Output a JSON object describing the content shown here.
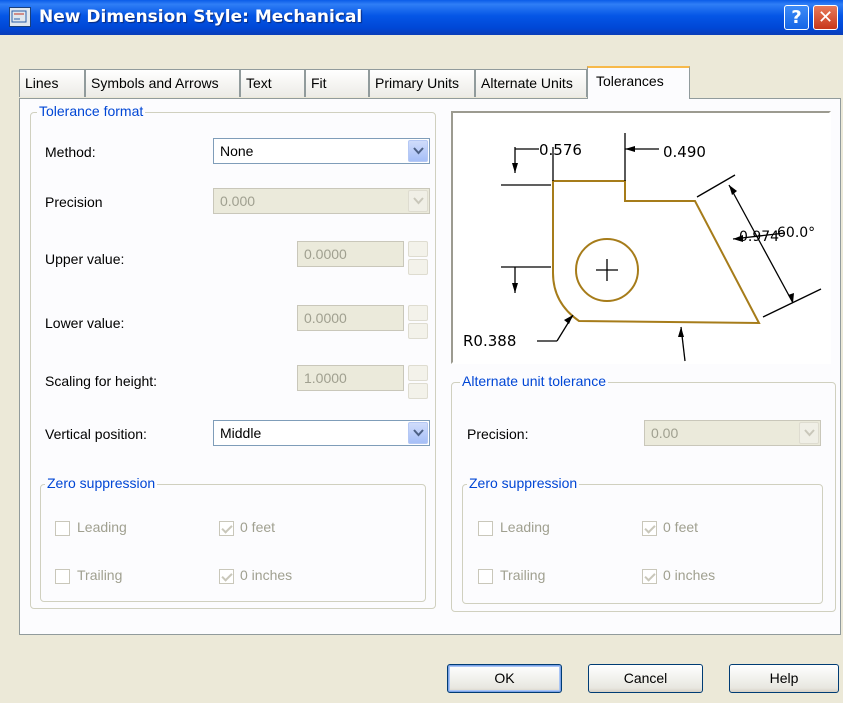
{
  "window": {
    "title": "New Dimension Style: Mechanical",
    "help_glyph": "?",
    "close_glyph": "✕"
  },
  "tabs": [
    "Lines",
    "Symbols and Arrows",
    "Text",
    "Fit",
    "Primary Units",
    "Alternate Units",
    "Tolerances"
  ],
  "active_tab": "Tolerances",
  "tolerance_format": {
    "legend": "Tolerance format",
    "method_label": "Method:",
    "method_value": "None",
    "precision_label": "Precision",
    "precision_value": "0.000",
    "upper_label": "Upper value:",
    "upper_value": "0.0000",
    "lower_label": "Lower value:",
    "lower_value": "0.0000",
    "scaling_label": "Scaling for height:",
    "scaling_value": "1.0000",
    "vertical_label": "Vertical position:",
    "vertical_value": "Middle",
    "zero": {
      "legend": "Zero suppression",
      "leading": "Leading",
      "trailing": "Trailing",
      "feet": "0 feet",
      "inches": "0 inches"
    }
  },
  "alternate": {
    "legend": "Alternate unit tolerance",
    "precision_label": "Precision:",
    "precision_value": "0.00",
    "zero": {
      "legend": "Zero suppression",
      "leading": "Leading",
      "trailing": "Trailing",
      "feet": "0 feet",
      "inches": "0 inches"
    }
  },
  "preview": {
    "dim_top_left": "0.576",
    "dim_top_right": "0.490",
    "dim_angle": "60.0°",
    "dim_right": "0.974",
    "dim_radius": "R0.388"
  },
  "buttons": {
    "ok": "OK",
    "cancel": "Cancel",
    "help": "Help"
  },
  "checkbox_states": {
    "leading": false,
    "trailing": false,
    "feet": true,
    "inches": true
  }
}
